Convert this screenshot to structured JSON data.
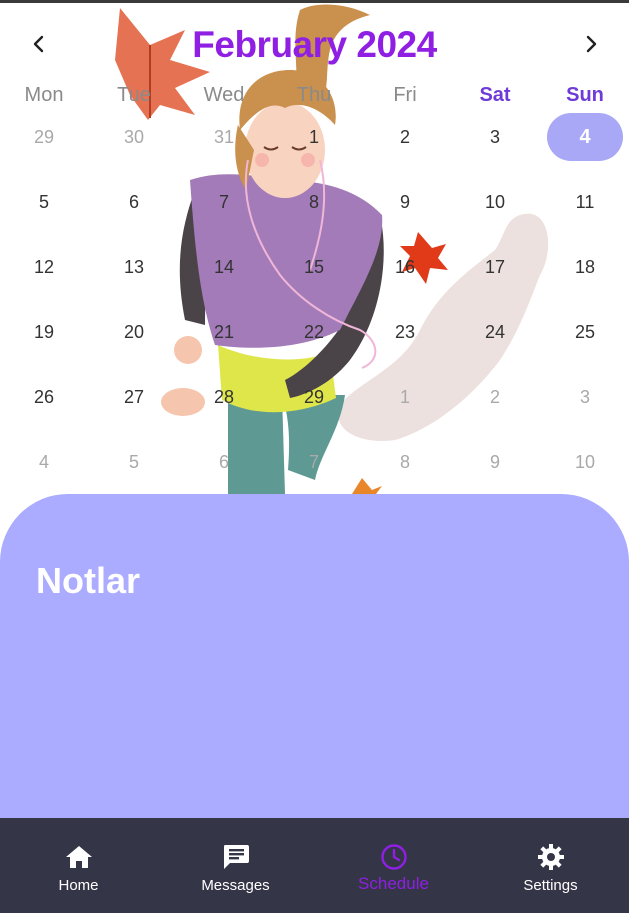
{
  "calendar": {
    "title": "February 2024",
    "prev_icon": "chevron-left-icon",
    "next_icon": "chevron-right-icon",
    "weekdays": [
      "Mon",
      "Tue",
      "Wed",
      "Thu",
      "Fri",
      "Sat",
      "Sun"
    ],
    "weeks": [
      [
        {
          "d": "29",
          "muted": true
        },
        {
          "d": "30",
          "muted": true
        },
        {
          "d": "31",
          "muted": true
        },
        {
          "d": "1"
        },
        {
          "d": "2"
        },
        {
          "d": "3"
        },
        {
          "d": "4",
          "selected": true
        }
      ],
      [
        {
          "d": "5"
        },
        {
          "d": "6"
        },
        {
          "d": "7"
        },
        {
          "d": "8"
        },
        {
          "d": "9"
        },
        {
          "d": "10"
        },
        {
          "d": "11"
        }
      ],
      [
        {
          "d": "12"
        },
        {
          "d": "13"
        },
        {
          "d": "14"
        },
        {
          "d": "15"
        },
        {
          "d": "16"
        },
        {
          "d": "17"
        },
        {
          "d": "18"
        }
      ],
      [
        {
          "d": "19"
        },
        {
          "d": "20"
        },
        {
          "d": "21"
        },
        {
          "d": "22"
        },
        {
          "d": "23"
        },
        {
          "d": "24"
        },
        {
          "d": "25"
        }
      ],
      [
        {
          "d": "26"
        },
        {
          "d": "27"
        },
        {
          "d": "28"
        },
        {
          "d": "29"
        },
        {
          "d": "1",
          "muted": true
        },
        {
          "d": "2",
          "muted": true
        },
        {
          "d": "3",
          "muted": true
        }
      ],
      [
        {
          "d": "4",
          "muted": true
        },
        {
          "d": "5",
          "muted": true
        },
        {
          "d": "6",
          "muted": true
        },
        {
          "d": "7",
          "muted": true
        },
        {
          "d": "8",
          "muted": true
        },
        {
          "d": "9",
          "muted": true
        },
        {
          "d": "10",
          "muted": true
        }
      ]
    ]
  },
  "notes": {
    "title": "Notlar"
  },
  "bottom_nav": {
    "items": [
      {
        "label": "Home",
        "icon": "home-icon"
      },
      {
        "label": "Messages",
        "icon": "message-icon"
      },
      {
        "label": "Schedule",
        "icon": "clock-icon",
        "active": true
      },
      {
        "label": "Settings",
        "icon": "gear-icon"
      }
    ]
  },
  "colors": {
    "accent": "#8e1fe3",
    "weekend": "#6f3bd8",
    "selected_bg": "#a8a8f7",
    "notes_bg": "#ababff",
    "nav_bg": "#353548"
  }
}
